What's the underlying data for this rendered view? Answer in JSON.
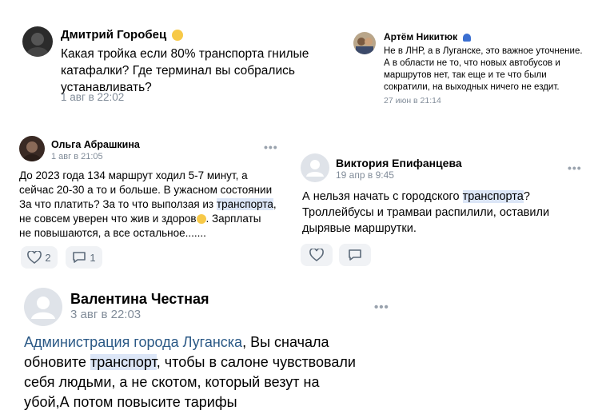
{
  "comments": {
    "c1": {
      "author": "Дмитрий Горобец",
      "lines": [
        "Какая тройка если 80% транспорта гнилые",
        "катафалки? Где терминал вы собрались",
        "устанавливать?"
      ],
      "date": "1 авг в 22:02"
    },
    "c2": {
      "author": "Артём Никитюк",
      "lines": [
        "Не в ЛНР, а в Луганске, это важное уточнение.",
        "А в области не то, что новых автобусов и",
        "маршрутов нет, так еще и те что были",
        "сократили, на выходных ничего не ездит."
      ],
      "date": "27 июн в 21:14"
    },
    "c3": {
      "author": "Ольга Абрашкина",
      "date": "1 авг в 21:05",
      "line1": "До 2023 года 134 маршрут ходил 5-7 минут, а",
      "line2": "сейчас 20-30 а то и больше. В ужасном состоянии",
      "line3_pre": "За что платить? За то что выползая из ",
      "line3_hl": "транспорта",
      "line3_post": ",",
      "line4": "не совсем уверен что жив и здоров",
      "line4_post": ". Зарплаты",
      "line5": "не повышаются, а все остальное.......",
      "likes": "2",
      "replies": "1"
    },
    "c4": {
      "author": "Виктория Епифанцева",
      "date": "19 апр в 9:45",
      "line1_pre": "А нельзя начать с городского ",
      "line1_hl": "транспорта",
      "line1_post": "?",
      "line2": "Троллейбусы и трамваи распилили, оставили",
      "line3": "дырявые маршрутки."
    },
    "c5": {
      "author": "Валентина Честная",
      "date": "3 авг в 22:03",
      "line1_link": "Администрация города Луганска",
      "line1_post": ", Вы сначала",
      "line2_pre": "обновите ",
      "line2_hl": "транспорт",
      "line2_post": ", чтобы в салоне чувствовали",
      "line3": "себя людьми, а не скотом, который везут на",
      "line4": "убой,А потом повысите тарифы"
    }
  },
  "colors": {
    "date": "#818c99",
    "highlight": "#dce6f7",
    "link": "#2a5885",
    "pill_bg": "#f0f2f5"
  },
  "icons": [
    "smile-emoji",
    "sad-emoji",
    "blue-cap-emoji",
    "more-dots-icon",
    "heart-icon",
    "comment-icon",
    "user-placeholder-icon"
  ]
}
